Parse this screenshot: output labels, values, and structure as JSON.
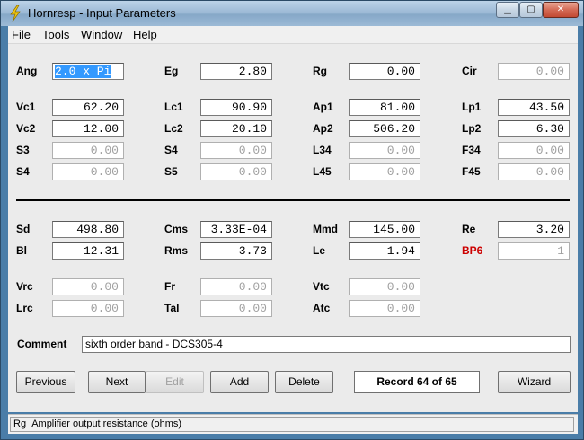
{
  "window": {
    "title": "Hornresp - Input Parameters"
  },
  "menu": {
    "file": "File",
    "tools": "Tools",
    "window": "Window",
    "help": "Help"
  },
  "fields": {
    "ang": {
      "label": "Ang",
      "value": "2.0 x Pi"
    },
    "eg": {
      "label": "Eg",
      "value": "2.80"
    },
    "rg": {
      "label": "Rg",
      "value": "0.00"
    },
    "cir": {
      "label": "Cir",
      "value": "0.00"
    },
    "vc1": {
      "label": "Vc1",
      "value": "62.20"
    },
    "lc1": {
      "label": "Lc1",
      "value": "90.90"
    },
    "ap1": {
      "label": "Ap1",
      "value": "81.00"
    },
    "lp1": {
      "label": "Lp1",
      "value": "43.50"
    },
    "vc2": {
      "label": "Vc2",
      "value": "12.00"
    },
    "lc2": {
      "label": "Lc2",
      "value": "20.10"
    },
    "ap2": {
      "label": "Ap2",
      "value": "506.20"
    },
    "lp2": {
      "label": "Lp2",
      "value": "6.30"
    },
    "s3": {
      "label": "S3",
      "value": "0.00"
    },
    "s4a": {
      "label": "S4",
      "value": "0.00"
    },
    "l34": {
      "label": "L34",
      "value": "0.00"
    },
    "f34": {
      "label": "F34",
      "value": "0.00"
    },
    "s4b": {
      "label": "S4",
      "value": "0.00"
    },
    "s5": {
      "label": "S5",
      "value": "0.00"
    },
    "l45": {
      "label": "L45",
      "value": "0.00"
    },
    "f45": {
      "label": "F45",
      "value": "0.00"
    },
    "sd": {
      "label": "Sd",
      "value": "498.80"
    },
    "cms": {
      "label": "Cms",
      "value": "3.33E-04"
    },
    "mmd": {
      "label": "Mmd",
      "value": "145.00"
    },
    "re": {
      "label": "Re",
      "value": "3.20"
    },
    "bl": {
      "label": "Bl",
      "value": "12.31"
    },
    "rms": {
      "label": "Rms",
      "value": "3.73"
    },
    "le": {
      "label": "Le",
      "value": "1.94"
    },
    "bp6": {
      "label": "BP6",
      "value": "1"
    },
    "vrc": {
      "label": "Vrc",
      "value": "0.00"
    },
    "fr": {
      "label": "Fr",
      "value": "0.00"
    },
    "vtc": {
      "label": "Vtc",
      "value": "0.00"
    },
    "lrc": {
      "label": "Lrc",
      "value": "0.00"
    },
    "tal": {
      "label": "Tal",
      "value": "0.00"
    },
    "atc": {
      "label": "Atc",
      "value": "0.00"
    }
  },
  "comment": {
    "label": "Comment",
    "value": "sixth order band - DCS305-4"
  },
  "buttons": {
    "previous": "Previous",
    "next": "Next",
    "edit": "Edit",
    "add": "Add",
    "delete": "Delete",
    "wizard": "Wizard"
  },
  "record": "Record 64 of 65",
  "status": {
    "param": "Rg",
    "text": "Amplifier output resistance  (ohms)"
  },
  "colors": {
    "accent_red": "#cc0000",
    "selection": "#3399ff"
  }
}
